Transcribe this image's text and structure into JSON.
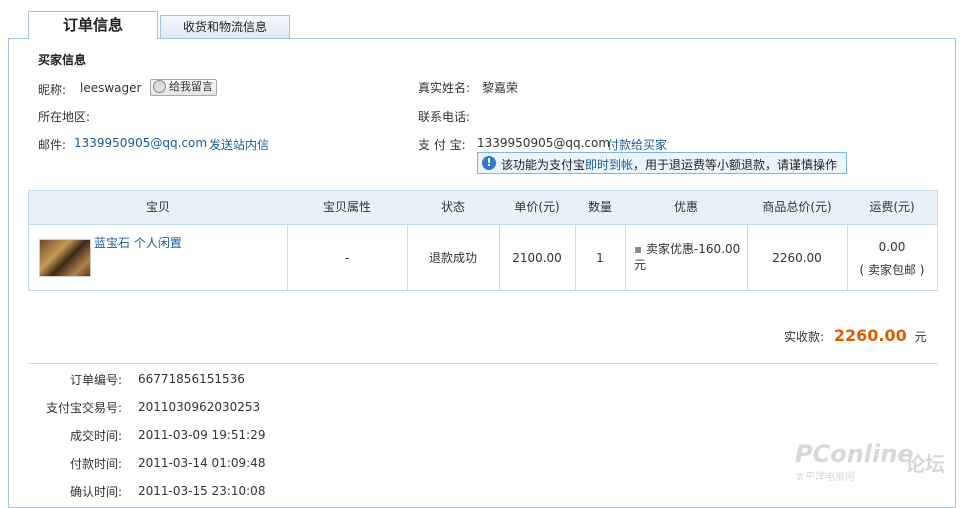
{
  "tabs": [
    {
      "label": "订单信息",
      "active": true
    },
    {
      "label": "收货和物流信息",
      "active": false
    }
  ],
  "buyer": {
    "section_title": "买家信息",
    "nickname_label": "昵称:",
    "nickname": "leeswager",
    "message_button": "给我留言",
    "realname_label": "真实姓名:",
    "realname": "黎嘉荣",
    "region_label": "所在地区:",
    "region": "",
    "phone_label": "联系电话:",
    "phone": "",
    "email_label": "邮件:",
    "email": "1339950905@qq.com",
    "send_msg_link": "发送站内信",
    "alipay_label": "支 付 宝:",
    "alipay": "1339950905@qq.com",
    "pay_buyer_link": "付款给买家"
  },
  "tip": {
    "icon": "info-icon",
    "text_before": "该功能为支付宝",
    "text_link": "即时到帐",
    "text_after": "，用于退运费等小额退款，请谨慎操作"
  },
  "table": {
    "headers": [
      "宝贝",
      "宝贝属性",
      "状态",
      "单价(元)",
      "数量",
      "优惠",
      "商品总价(元)",
      "运费(元)"
    ],
    "row": {
      "item_title": "蓝宝石 个人闲置",
      "attribute": "-",
      "status": "退款成功",
      "unit_price": "2100.00",
      "quantity": "1",
      "discount": "卖家优惠-160.00元",
      "total": "2260.00",
      "shipping": "0.00",
      "shipping_note": "( 卖家包邮 )"
    }
  },
  "summary": {
    "received_label": "实收款:",
    "received_amount": "2260.00",
    "currency": "元"
  },
  "order_info": [
    {
      "label": "订单编号:",
      "value": "66771856151536"
    },
    {
      "label": "支付宝交易号:",
      "value": "2011030962030253"
    },
    {
      "label": "成交时间:",
      "value": "2011-03-09 19:51:29"
    },
    {
      "label": "付款时间:",
      "value": "2011-03-14 01:09:48"
    },
    {
      "label": "确认时间:",
      "value": "2011-03-15 23:10:08"
    }
  ],
  "watermark": {
    "brand": "PConline",
    "forum": "论坛",
    "sub": "太平洋电脑网"
  },
  "colors": {
    "accent_link": "#1d5b99",
    "amount_orange": "#e35b00",
    "border_blue": "#9ec5e8"
  }
}
